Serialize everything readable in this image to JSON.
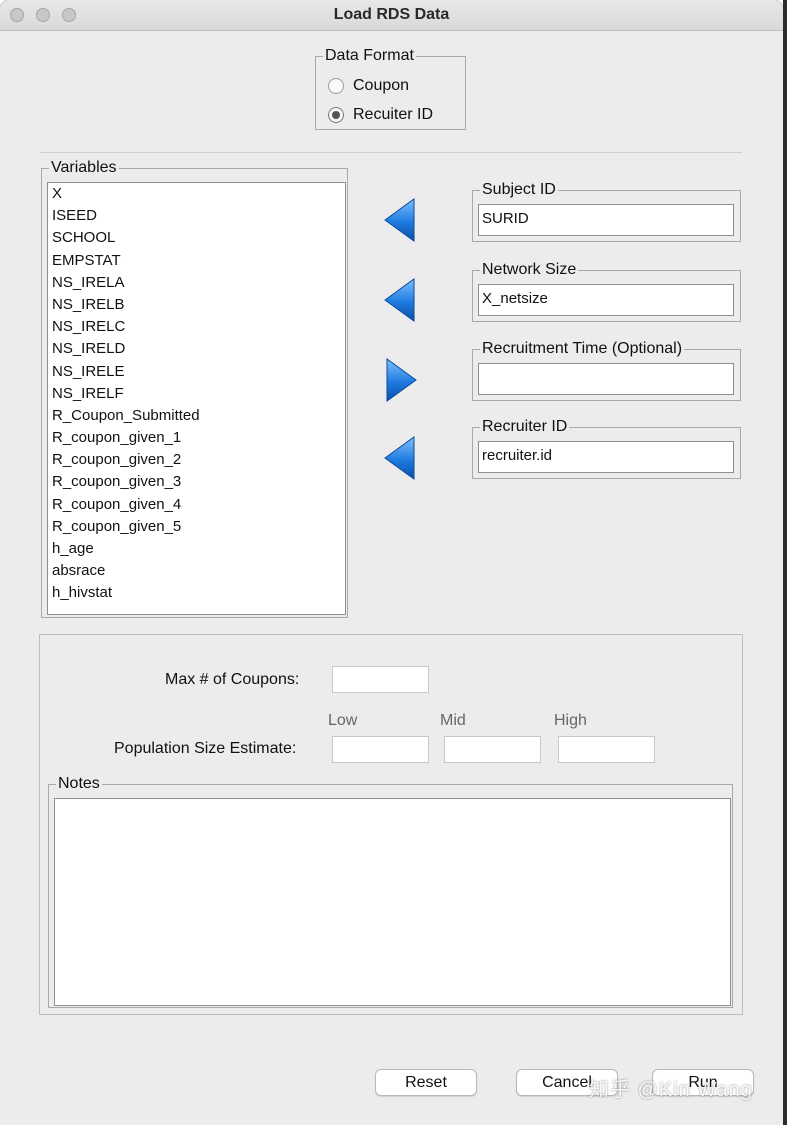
{
  "window": {
    "title": "Load RDS Data"
  },
  "data_format": {
    "legend": "Data Format",
    "options": [
      {
        "label": "Coupon",
        "selected": false
      },
      {
        "label": "Recuiter ID",
        "selected": true
      }
    ]
  },
  "variables": {
    "legend": "Variables",
    "items": [
      "X",
      "ISEED",
      "SCHOOL",
      "EMPSTAT",
      "NS_IRELA",
      "NS_IRELB",
      "NS_IRELC",
      "NS_IRELD",
      "NS_IRELE",
      "NS_IRELF",
      "R_Coupon_Submitted",
      "R_coupon_given_1",
      "R_coupon_given_2",
      "R_coupon_given_3",
      "R_coupon_given_4",
      "R_coupon_given_5",
      "h_age",
      "absrace",
      "h_hivstat"
    ]
  },
  "fields": {
    "subject_id": {
      "legend": "Subject ID",
      "value": "SURID",
      "arrow": "arrow-left-icon"
    },
    "network_size": {
      "legend": "Network Size",
      "value": "X_netsize",
      "arrow": "arrow-left-icon"
    },
    "recruitment_time": {
      "legend": "Recruitment Time (Optional)",
      "value": "",
      "arrow": "arrow-right-icon"
    },
    "recruiter_id": {
      "legend": "Recruiter ID",
      "value": "recruiter.id",
      "arrow": "arrow-left-icon"
    }
  },
  "options": {
    "max_coupons_label": "Max # of Coupons:",
    "max_coupons_value": "",
    "pop_size_label": "Population Size Estimate:",
    "low_label": "Low",
    "mid_label": "Mid",
    "high_label": "High",
    "low_value": "",
    "mid_value": "",
    "high_value": ""
  },
  "notes": {
    "legend": "Notes",
    "value": ""
  },
  "buttons": {
    "reset": "Reset",
    "cancel": "Cancel",
    "run": "Run"
  },
  "watermark": "知乎 @Kin Wang",
  "colors": {
    "arrow_blue": "#1f7be0",
    "window_bg": "#ececec"
  }
}
